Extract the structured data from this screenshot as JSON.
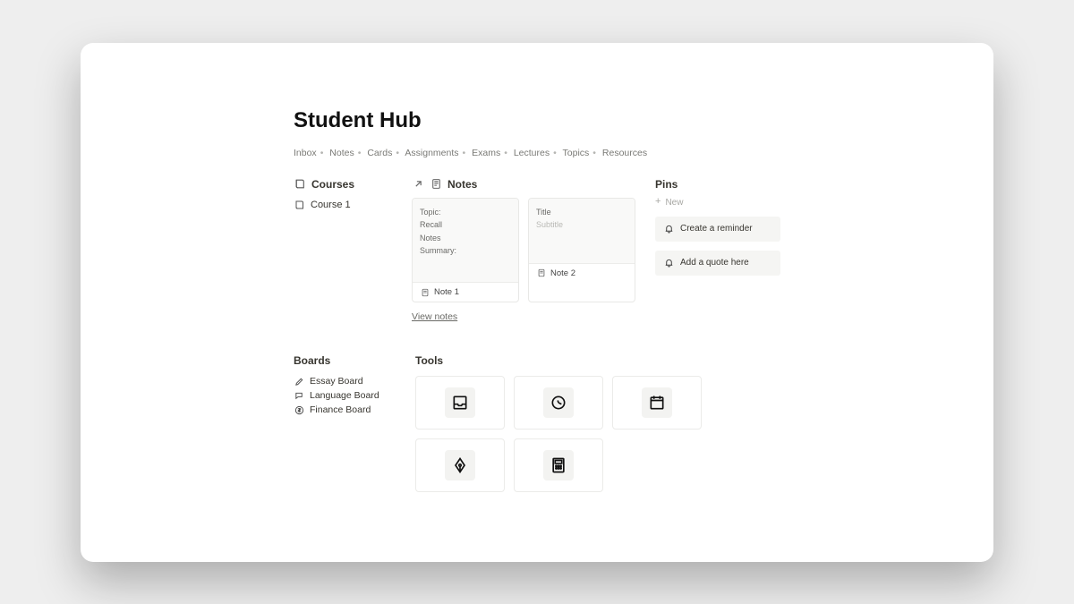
{
  "title": "Student Hub",
  "nav": [
    "Inbox",
    "Notes",
    "Cards",
    "Assignments",
    "Exams",
    "Lectures",
    "Topics",
    "Resources"
  ],
  "courses": {
    "heading": "Courses",
    "items": [
      "Course 1"
    ]
  },
  "notes": {
    "heading": "Notes",
    "cards": [
      {
        "lines": [
          "Topic:",
          "Recall",
          "Notes",
          "Summary:"
        ],
        "title": "Note 1"
      },
      {
        "titleline": "Title",
        "subtitle": "Subtitle",
        "title": "Note 2"
      }
    ],
    "viewAll": "View notes"
  },
  "pins": {
    "heading": "Pins",
    "newLabel": "New",
    "items": [
      "Create a reminder",
      "Add a quote here"
    ]
  },
  "boards": {
    "heading": "Boards",
    "items": [
      "Essay Board",
      "Language Board",
      "Finance Board"
    ]
  },
  "tools": {
    "heading": "Tools",
    "items": [
      "inbox",
      "clock",
      "calendar",
      "pen",
      "calculator"
    ]
  }
}
